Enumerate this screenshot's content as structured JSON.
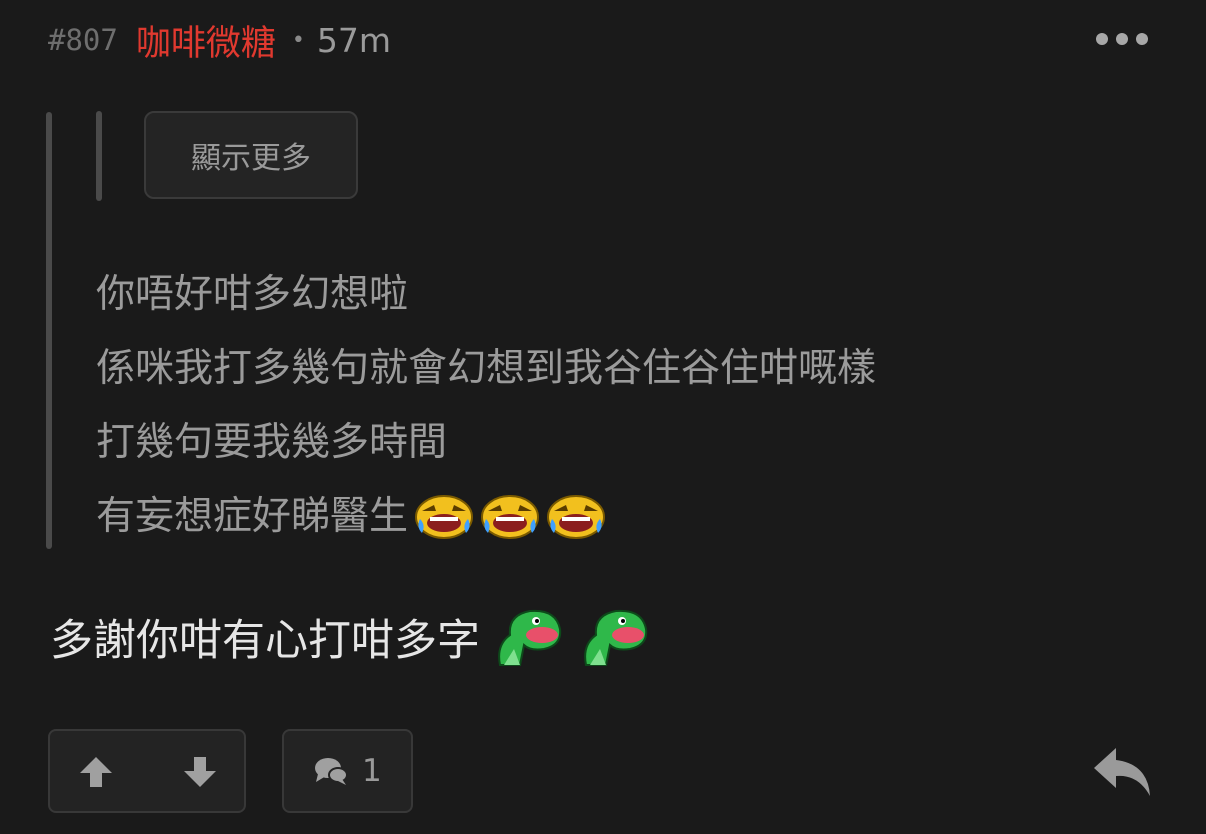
{
  "colors": {
    "background": "#1a1a1a",
    "username": "#e0392f",
    "quote_text": "#9b9b9b",
    "reply_text": "#e6e6e6"
  },
  "post": {
    "floor": "#807",
    "username": "咖啡微糖",
    "separator": "•",
    "time": "57m"
  },
  "quote": {
    "show_more_label": "顯示更多",
    "lines": [
      "你唔好咁多幻想啦",
      "係咪我打多幾句就會幻想到我谷住谷住咁嘅樣",
      "打幾句要我幾多時間",
      "有妄想症好睇醫生"
    ],
    "trailing_emoji": "laugh-cry-emoji",
    "trailing_emoji_count": 3
  },
  "reply": {
    "text": "多謝你咁有心打咁多字",
    "trailing_emoji": "green-dino-emoji",
    "trailing_emoji_count": 2
  },
  "actions": {
    "upvote_icon": "arrow-up-icon",
    "downvote_icon": "arrow-down-icon",
    "comment_icon": "speech-bubbles-icon",
    "comment_count": "1",
    "reply_icon": "reply-arrow-icon",
    "more_icon": "more-dots-icon"
  }
}
